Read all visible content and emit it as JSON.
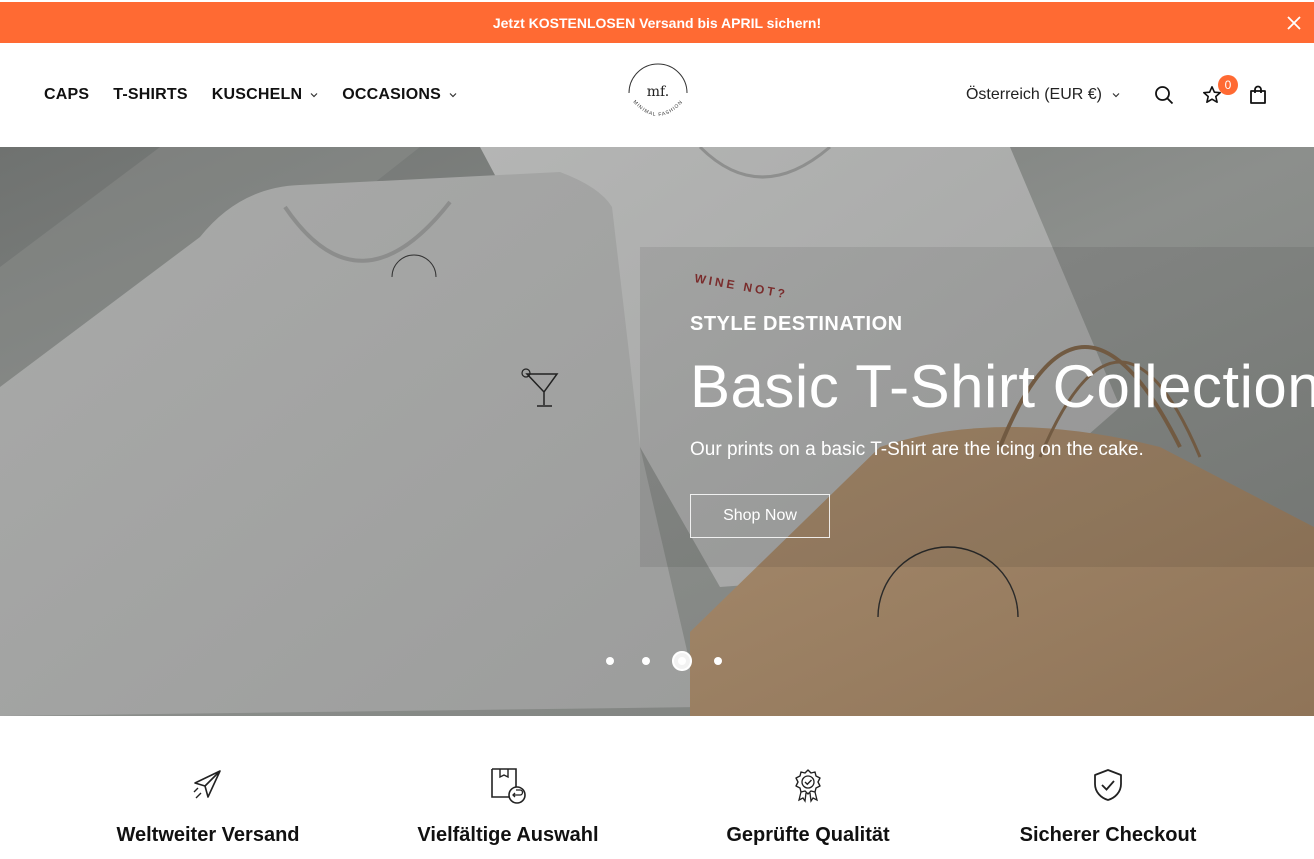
{
  "announcement": {
    "text": "Jetzt KOSTENLOSEN Versand bis APRIL sichern!"
  },
  "nav": [
    {
      "label": "CAPS",
      "dropdown": false
    },
    {
      "label": "T-SHIRTS",
      "dropdown": false
    },
    {
      "label": "KUSCHELN",
      "dropdown": true
    },
    {
      "label": "OCCASIONS",
      "dropdown": true
    }
  ],
  "logo": {
    "mark": "mf.",
    "tagline": "MINIMAL FASHION"
  },
  "header": {
    "country": "Österreich (EUR €)",
    "wishlist_count": "0"
  },
  "hero": {
    "eyebrow": "STYLE DESTINATION",
    "title": "Basic T-Shirt Collection",
    "subtitle": "Our prints on a basic T-Shirt are the icing on the cake.",
    "button": "Shop Now",
    "shirt_print": "WINE NOT?",
    "slides_total": 4,
    "active_slide": 3
  },
  "features": [
    {
      "icon": "airplane-icon",
      "title": "Weltweiter Versand"
    },
    {
      "icon": "box-return-icon",
      "title": "Vielfältige Auswahl"
    },
    {
      "icon": "quality-badge-icon",
      "title": "Geprüfte Qualität"
    },
    {
      "icon": "shield-check-icon",
      "title": "Sicherer Checkout"
    }
  ],
  "colors": {
    "accent": "#ff6a33"
  }
}
